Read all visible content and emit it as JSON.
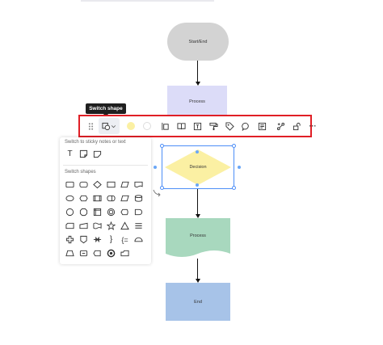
{
  "canvas": {
    "nodes": {
      "start": "Start/End",
      "process1": "Process",
      "decision": "Decision",
      "process2": "Process",
      "end": "End"
    },
    "colors": {
      "start": "#d3d3d3",
      "process1": "#dcdcf8",
      "decision": "#fbf0a3",
      "process2": "#a8d8be",
      "end": "#a7c3e8",
      "highlight": "#e01f26",
      "selection": "#4d8ef7"
    }
  },
  "tooltip": {
    "label": "Switch shape"
  },
  "toolbar": {
    "items": [
      "drag-handle-icon",
      "switch-shape-icon",
      "chevron-down-icon",
      "fill-color-swatch",
      "stroke-color-swatch",
      "text-align-icon",
      "book-open-icon",
      "text-frame-icon",
      "paint-roller-icon",
      "tag-icon",
      "comment-icon",
      "note-icon",
      "connector-icon",
      "lock-icon",
      "more-icon"
    ],
    "more_label": "···"
  },
  "shape_panel": {
    "sticky_title": "Switch to sticky notes or text",
    "shapes_title": "Switch shapes",
    "sticky_items": [
      "text-icon",
      "sticky-note-icon",
      "sticky-note-fold-icon"
    ]
  }
}
